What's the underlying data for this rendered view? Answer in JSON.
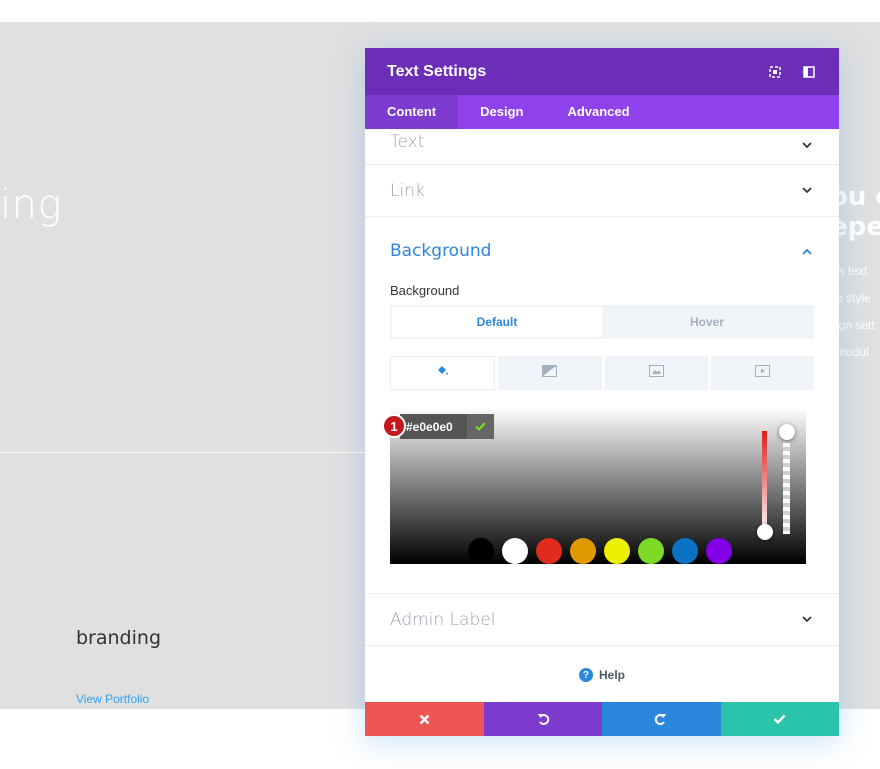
{
  "background_page": {
    "heading_fragment": "ing",
    "right_heading_lines": [
      "ou c",
      "epe"
    ],
    "right_text_lines": [
      "is text",
      "o style",
      "ign sett",
      "modul"
    ],
    "branding": "branding",
    "view_portfolio": "View Portfolio"
  },
  "modal": {
    "title": "Text Settings",
    "header_icons": [
      "expand-icon",
      "sidebar-layout-icon"
    ],
    "tabs": [
      {
        "label": "Content",
        "active": true
      },
      {
        "label": "Design",
        "active": false
      },
      {
        "label": "Advanced",
        "active": false
      }
    ],
    "sections": {
      "text": "Text",
      "link": "Link",
      "background": "Background",
      "admin_label": "Admin Label"
    },
    "background": {
      "field_label": "Background",
      "state_tabs": [
        {
          "label": "Default",
          "active": true
        },
        {
          "label": "Hover",
          "active": false
        }
      ],
      "type_tabs": [
        {
          "icon": "paint-bucket-icon",
          "active": true
        },
        {
          "icon": "gradient-icon",
          "active": false
        },
        {
          "icon": "image-icon",
          "active": false
        },
        {
          "icon": "video-icon",
          "active": false
        }
      ],
      "hex_value": "#e0e0e0",
      "step_badge": "1",
      "swatches": [
        "#000000",
        "#ffffff",
        "#e02b20",
        "#e09900",
        "#edf000",
        "#7cda24",
        "#0c71c3",
        "#8300e9"
      ]
    },
    "help": "Help",
    "colors": {
      "header": "#6c2eb9",
      "tabs": "#8f42ec",
      "accent_blue": "#2b87da",
      "cancel": "#ef5555",
      "undo": "#7e3bd0",
      "redo": "#2b87da",
      "save": "#29c4a9"
    },
    "footer_buttons": [
      "close-icon",
      "undo-icon",
      "redo-icon",
      "check-icon"
    ]
  }
}
